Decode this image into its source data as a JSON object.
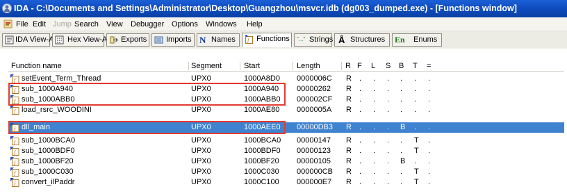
{
  "window": {
    "title": "IDA - C:\\Documents and Settings\\Administrator\\Desktop\\Guangzhou\\msvcr.idb (dg003_dumped.exe) - [Functions window]"
  },
  "menu": [
    "File",
    "Edit",
    "Jump",
    "Search",
    "View",
    "Debugger",
    "Options",
    "Windows",
    "Help"
  ],
  "tabs": [
    "IDA View-A",
    "Hex View-A",
    "Exports",
    "Imports",
    "Names",
    "Functions",
    "Strings",
    "Structures",
    "Enums"
  ],
  "tab_icons": {
    "Names": "N",
    "Structures": "Å",
    "Enums": "En",
    "Strings": "\"...\""
  },
  "columns": [
    "Function name",
    "Segment",
    "Start",
    "Length",
    "R",
    "F",
    "L",
    "S",
    "B",
    "T",
    "="
  ],
  "rows": [
    {
      "name": "setEvent_Term_Thread",
      "segment": "UPX0",
      "start": "1000A8D0",
      "length": "0000006C",
      "flags": [
        "R",
        ".",
        ".",
        ".",
        ".",
        ".",
        "."
      ]
    },
    {
      "name": "sub_1000A940",
      "segment": "UPX0",
      "start": "1000A940",
      "length": "00000262",
      "flags": [
        "R",
        ".",
        ".",
        ".",
        ".",
        ".",
        "."
      ]
    },
    {
      "name": "sub_1000ABB0",
      "segment": "UPX0",
      "start": "1000ABB0",
      "length": "000002CF",
      "flags": [
        "R",
        ".",
        ".",
        ".",
        ".",
        ".",
        "."
      ]
    },
    {
      "name": "load_rsrc_WOODINI",
      "segment": "UPX0",
      "start": "1000AE80",
      "length": "0000005A",
      "flags": [
        "R",
        ".",
        ".",
        ".",
        ".",
        ".",
        "."
      ]
    },
    {
      "name": "dll_main",
      "segment": "UPX0",
      "start": "1000AEE0",
      "length": "00000DB3",
      "flags": [
        "R",
        ".",
        ".",
        ".",
        "B",
        ".",
        "."
      ]
    },
    {
      "name": "sub_1000BCA0",
      "segment": "UPX0",
      "start": "1000BCA0",
      "length": "00000147",
      "flags": [
        "R",
        ".",
        ".",
        ".",
        ".",
        "T",
        "."
      ]
    },
    {
      "name": "sub_1000BDF0",
      "segment": "UPX0",
      "start": "1000BDF0",
      "length": "00000123",
      "flags": [
        "R",
        ".",
        ".",
        ".",
        ".",
        "T",
        "."
      ]
    },
    {
      "name": "sub_1000BF20",
      "segment": "UPX0",
      "start": "1000BF20",
      "length": "00000105",
      "flags": [
        "R",
        ".",
        ".",
        ".",
        "B",
        ".",
        "."
      ]
    },
    {
      "name": "sub_1000C030",
      "segment": "UPX0",
      "start": "1000C030",
      "length": "000000CB",
      "flags": [
        "R",
        ".",
        ".",
        ".",
        ".",
        "T",
        "."
      ]
    },
    {
      "name": "convert_ilPaddr",
      "segment": "UPX0",
      "start": "1000C100",
      "length": "000000E7",
      "flags": [
        "R",
        ".",
        ".",
        ".",
        ".",
        "T",
        "."
      ]
    }
  ],
  "selected_row": 4,
  "colors": {
    "titlebar": "#0d49b8",
    "selection": "#3f83d0",
    "highlight_box": "#e23b2e"
  },
  "icons": {
    "app": "ida-logo-icon",
    "function": "function-icon",
    "mdi": "mdi-child-icon"
  }
}
